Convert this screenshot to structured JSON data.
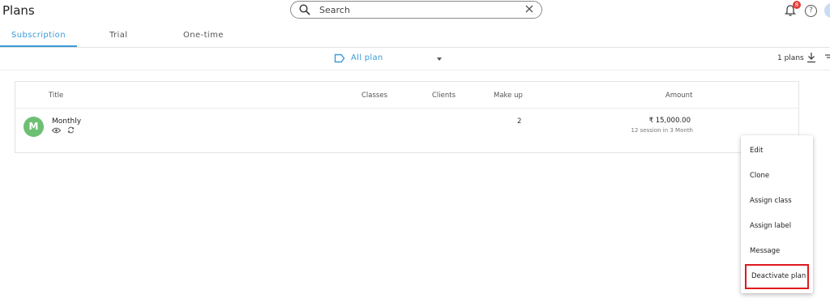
{
  "header": {
    "title": "Plans",
    "search_placeholder": "Search",
    "notification_count": "8"
  },
  "tabs": [
    {
      "label": "Subscription",
      "active": true
    },
    {
      "label": "Trial",
      "active": false
    },
    {
      "label": "One-time",
      "active": false
    }
  ],
  "filter": {
    "selected": "All plan",
    "plan_count": "1 plans"
  },
  "table": {
    "columns": [
      "Title",
      "Classes",
      "Clients",
      "Make up",
      "Amount"
    ],
    "rows": [
      {
        "avatar_letter": "M",
        "title": "Monthly",
        "classes": "",
        "clients": "",
        "makeup": "2",
        "amount": "₹ 15,000.00",
        "amount_detail": "12 session in 3 Month"
      }
    ]
  },
  "context_menu": {
    "items": [
      "Edit",
      "Clone",
      "Assign class",
      "Assign label",
      "Message",
      "Deactivate plan"
    ],
    "highlighted": "Deactivate plan"
  },
  "colors": {
    "accent": "#3a9bd9",
    "avatar": "#6cbf73",
    "badge": "#e53935",
    "highlight_border": "#e0191f"
  },
  "icons": [
    "search-icon",
    "close-icon",
    "bell-icon",
    "help-icon",
    "label-icon",
    "caret-down-icon",
    "download-icon",
    "eye-icon",
    "sync-icon"
  ]
}
